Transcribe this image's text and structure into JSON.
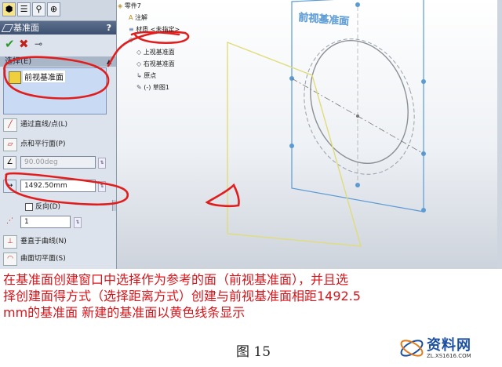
{
  "property_manager": {
    "tabs": [
      "feature-manager",
      "property-manager",
      "configuration-manager",
      "dimxpert-manager"
    ],
    "title": "基准面",
    "help": "?",
    "ok": "✔",
    "cancel": "✖",
    "pin": "⊸",
    "section_label": "选择(E)",
    "reference": "前视基准面",
    "options": [
      {
        "icon": "through-line-icon",
        "label": "通过直线/点(L)"
      },
      {
        "icon": "point-parallel-icon",
        "label": "点和平行面(P)"
      }
    ],
    "angle_value": "90.00deg",
    "distance_value": "1492.50mm",
    "reverse_label": "反向(D)",
    "count_value": "1",
    "options_bottom": [
      {
        "icon": "normal-to-curve-icon",
        "label": "垂直于曲线(N)"
      },
      {
        "icon": "on-surface-icon",
        "label": "曲面切平面(S)"
      }
    ]
  },
  "feature_tree": {
    "root": "零件7",
    "items": [
      "注解",
      "材质 <未指定>",
      "前视基准面",
      "上视基准面",
      "右视基准面",
      "原点",
      "(-) 草图1"
    ]
  },
  "viewport": {
    "front_plane_label": "前视基准面",
    "new_plane_color": "#e0dc7a",
    "front_plane_color": "#5b9bd5"
  },
  "annotation": {
    "lines": [
      "在基准面创建窗口中选择作为参考的面（前视基准面），并且选",
      "择创建面得方式（选择距离方式）创建与前视基准面相距1492.5",
      "mm的基准面 新建的基准面以黄色线条显示"
    ],
    "color": "#d8141a"
  },
  "figure_label": "图 15",
  "watermark": {
    "text": "资料网",
    "url": "ZL.XS1616.COM"
  }
}
